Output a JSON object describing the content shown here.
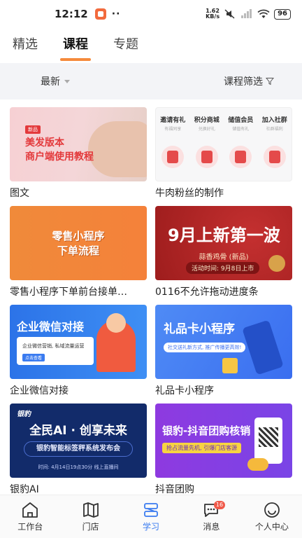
{
  "status_bar": {
    "time": "12:12",
    "net_speed_value": "1.62",
    "net_speed_unit": "KB/s",
    "battery": "96"
  },
  "top_tabs": [
    {
      "label": "精选",
      "active": false
    },
    {
      "label": "课程",
      "active": true
    },
    {
      "label": "专题",
      "active": false
    }
  ],
  "filter": {
    "sort_label": "最新",
    "course_filter_label": "课程筛选"
  },
  "courses": [
    {
      "title": "图文",
      "thumb": {
        "badge": "新品",
        "line1": "美发版本",
        "line2": "商户端使用教程"
      }
    },
    {
      "title": "牛肉粉丝的制作",
      "thumb": {
        "columns": [
          {
            "title": "邀请有礼",
            "sub": "有福同享"
          },
          {
            "title": "积分商城",
            "sub": "兑换好礼"
          },
          {
            "title": "储值会员",
            "sub": "储值有礼"
          },
          {
            "title": "加入社群",
            "sub": "社群福利"
          }
        ]
      }
    },
    {
      "title": "零售小程序下单前台接单…",
      "thumb": {
        "line1": "零售小程序",
        "line2": "下单流程"
      }
    },
    {
      "title": "0116不允许拖动进度条",
      "thumb": {
        "headline": "9月上新第一波",
        "sub": "蒜香鸡骨 (新品)",
        "pill": "活动时间: 9月8日上市"
      }
    },
    {
      "title": "企业微信对接",
      "thumb": {
        "headline": "企业微信对接",
        "box_text": "企业微信营销, 私域流量运营",
        "box_button": "点击查看"
      }
    },
    {
      "title": "礼品卡小程序",
      "thumb": {
        "headline": "礼品卡小程序",
        "pill": "社交送礼新方式, 推广传播更高效!"
      }
    },
    {
      "title": "银豹AI",
      "thumb": {
        "logo": "银豹",
        "headline": "全民AI · 创享未来",
        "sub": "银豹智能标签秤系统发布会",
        "footer": "时间: 4月14日19点30分 线上直播间"
      }
    },
    {
      "title": "抖音团购",
      "thumb": {
        "headline": "银豹-抖音团购核销",
        "pill": "抢占流量先机, 引爆门店客源"
      }
    }
  ],
  "bottom_nav": [
    {
      "label": "工作台",
      "icon": "home-icon",
      "active": false
    },
    {
      "label": "门店",
      "icon": "map-icon",
      "active": false
    },
    {
      "label": "学习",
      "icon": "learn-icon",
      "active": true
    },
    {
      "label": "消息",
      "icon": "message-icon",
      "active": false,
      "badge": "16"
    },
    {
      "label": "个人中心",
      "icon": "profile-icon",
      "active": false
    }
  ],
  "colors": {
    "accent": "#f58a3b",
    "nav_active": "#3a7bf0",
    "filter_bg": "#f3f4f7"
  }
}
